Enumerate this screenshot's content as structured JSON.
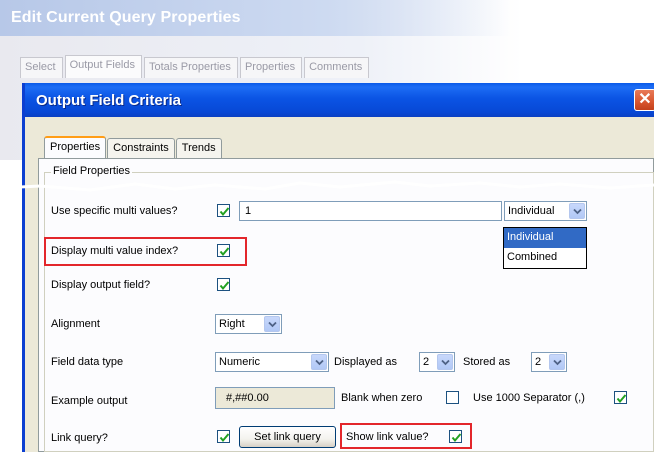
{
  "back_window": {
    "title": "Edit Current Query Properties",
    "tabs": [
      {
        "label": "Select",
        "active": false
      },
      {
        "label": "Output Fields",
        "active": true
      },
      {
        "label": "Totals Properties",
        "active": false
      },
      {
        "label": "Properties",
        "active": false
      },
      {
        "label": "Comments",
        "active": false
      }
    ]
  },
  "dialog": {
    "title": "Output Field Criteria",
    "close_symbol": "✕",
    "tabs": [
      {
        "label": "Properties",
        "active": true
      },
      {
        "label": "Constraints",
        "active": false
      },
      {
        "label": "Trends",
        "active": false
      }
    ],
    "group_label": "Field Properties",
    "rows": {
      "multi_values": {
        "label": "Use specific multi values?",
        "checked": true,
        "text_value": "1",
        "combo_value": "Individual"
      },
      "multi_index": {
        "label": "Display multi value index?",
        "checked": true
      },
      "output_field": {
        "label": "Display output field?",
        "checked": true
      },
      "alignment": {
        "label": "Alignment",
        "value": "Right"
      },
      "data_type": {
        "label": "Field data type",
        "value": "Numeric",
        "displayed_as_label": "Displayed as",
        "displayed_as_value": "2",
        "stored_as_label": "Stored as",
        "stored_as_value": "2"
      },
      "example": {
        "label": "Example output",
        "value": "#,##0.00",
        "blank_zero_label": "Blank when zero",
        "blank_zero_checked": false,
        "separator_label": "Use 1000 Separator (,)",
        "separator_checked": true
      },
      "link_query": {
        "label": "Link query?",
        "checked": true,
        "button_label": "Set link query",
        "show_link_label": "Show link value?",
        "show_link_checked": true
      }
    },
    "dropdown_options": [
      {
        "label": "Individual",
        "selected": true
      },
      {
        "label": "Combined",
        "selected": false
      }
    ]
  },
  "colors": {
    "title_bar": "#0b54e4",
    "highlight": "#e3262b",
    "selected_item": "#316ac5",
    "checkmark": "#21a121"
  }
}
